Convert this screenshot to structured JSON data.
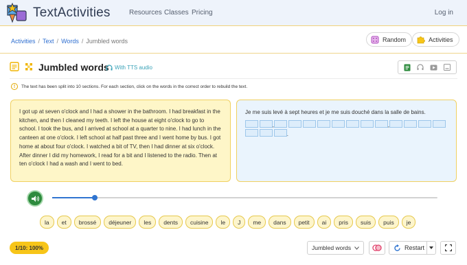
{
  "app": {
    "brand": "TextActivities"
  },
  "nav": {
    "resources": "Resources",
    "classes": "Classes",
    "pricing": "Pricing",
    "login": "Log in"
  },
  "breadcrumb": {
    "items": [
      "Activities",
      "Text",
      "Words"
    ],
    "current": "Jumbled words"
  },
  "actions": {
    "random": "Random",
    "activities": "Activities"
  },
  "activity": {
    "title": "Jumbled words",
    "tts": "With TTS audio",
    "info": "The text has been split into 10 sections. For each section, click on the words in the correct order to rebuild the text."
  },
  "source_text": "I got up at seven o'clock and I had a shower in the bathroom. I had breakfast in the kitchen, and then I cleaned my teeth. I left the house at eight o'clock to go to school. I took the bus, and I arrived at school at a quarter to nine. I had lunch in the canteen at one o'clock. I left school at half past three and I went home by bus. I got home at about four o'clock. I watched a bit of TV, then I had dinner at six o'clock. After dinner I did my homework, I read for a bit and I listened to the radio. Then at ten o'clock I had a wash and I went to bed.",
  "target_sentence": "Je me suis levé à sept heures et je me suis douché dans la salle de bains.",
  "slot_puncts": {
    "s1": ",",
    "s9": ",",
    "s16": "."
  },
  "audio": {
    "progress": 0.11
  },
  "word_bank": [
    "la",
    "et",
    "brossé",
    "déjeuner",
    "les",
    "dents",
    "cuisine",
    "le",
    "J",
    "me",
    "dans",
    "petit",
    "ai",
    "pris",
    "suis",
    "puis",
    "je"
  ],
  "footer": {
    "score": "1/10: 100%",
    "mode": "Jumbled words",
    "restart": "Restart"
  },
  "colors": {
    "accent": "#f7c519",
    "play": "#2e8b3e",
    "slider": "#2f74d0",
    "answer_bg": "#eaf4fd",
    "text_bg": "#fef6c8"
  }
}
